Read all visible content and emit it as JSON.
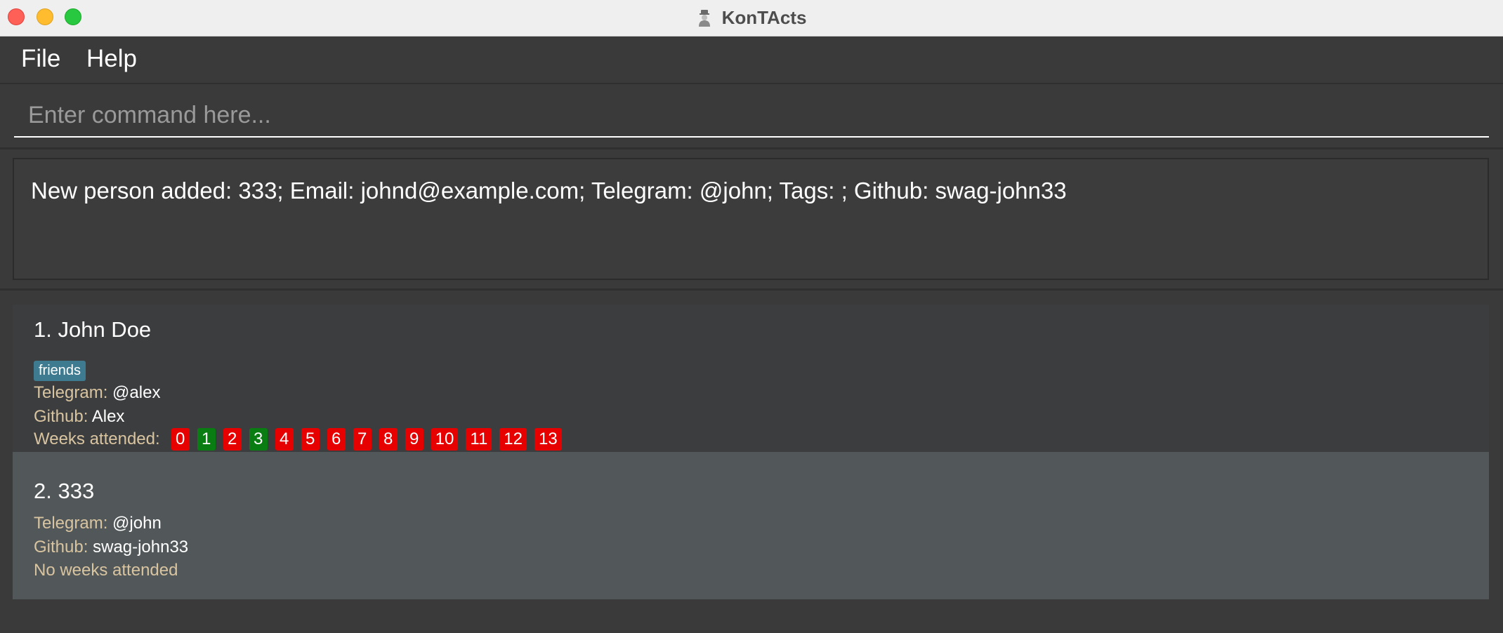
{
  "window": {
    "title": "KonTActs"
  },
  "menu": {
    "items": [
      "File",
      "Help"
    ]
  },
  "command": {
    "placeholder": "Enter command here...",
    "value": ""
  },
  "result": {
    "message": "New person added: 333; Email: johnd@example.com; Telegram: @john; Tags: ; Github: swag-john33"
  },
  "persons": [
    {
      "index_name": "1. John Doe",
      "tags": [
        "friends"
      ],
      "telegram_label": "Telegram:",
      "telegram": "@alex",
      "github_label": "Github:",
      "github": "Alex",
      "weeks_label": "Weeks attended:",
      "weeks": [
        {
          "week": "0",
          "attended": false
        },
        {
          "week": "1",
          "attended": true
        },
        {
          "week": "2",
          "attended": false
        },
        {
          "week": "3",
          "attended": true
        },
        {
          "week": "4",
          "attended": false
        },
        {
          "week": "5",
          "attended": false
        },
        {
          "week": "6",
          "attended": false
        },
        {
          "week": "7",
          "attended": false
        },
        {
          "week": "8",
          "attended": false
        },
        {
          "week": "9",
          "attended": false
        },
        {
          "week": "10",
          "attended": false
        },
        {
          "week": "11",
          "attended": false
        },
        {
          "week": "12",
          "attended": false
        },
        {
          "week": "13",
          "attended": false
        }
      ]
    },
    {
      "index_name": "2. 333",
      "tags": [],
      "telegram_label": "Telegram:",
      "telegram": "@john",
      "github_label": "Github:",
      "github": "swag-john33",
      "no_weeks_text": "No weeks attended"
    }
  ],
  "colors": {
    "attended": "#0a7d12",
    "absent": "#e60000",
    "tag": "#3e7b91",
    "label": "#d9c4a0"
  }
}
